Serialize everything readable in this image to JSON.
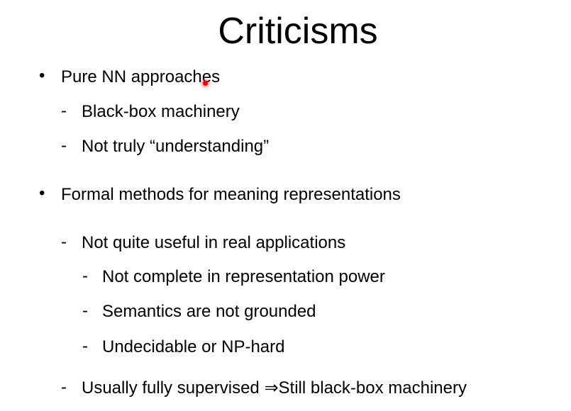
{
  "slide": {
    "title": "Criticisms",
    "items": [
      {
        "marker": "•",
        "text": "Pure NN approaches"
      },
      {
        "marker": "-",
        "text": "Black-box machinery"
      },
      {
        "marker": "-",
        "text": "Not truly “understanding”"
      },
      {
        "marker": "•",
        "text": "Formal methods for meaning representations"
      },
      {
        "marker": "-",
        "text": "Not quite useful in real applications"
      },
      {
        "marker": "-",
        "text": "Not complete in representation power"
      },
      {
        "marker": "-",
        "text": "Semantics are not grounded"
      },
      {
        "marker": "-",
        "text": "Undecidable or NP-hard"
      },
      {
        "marker": "-",
        "text": "Usually fully supervised ⇒Still black-box machinery"
      }
    ]
  }
}
